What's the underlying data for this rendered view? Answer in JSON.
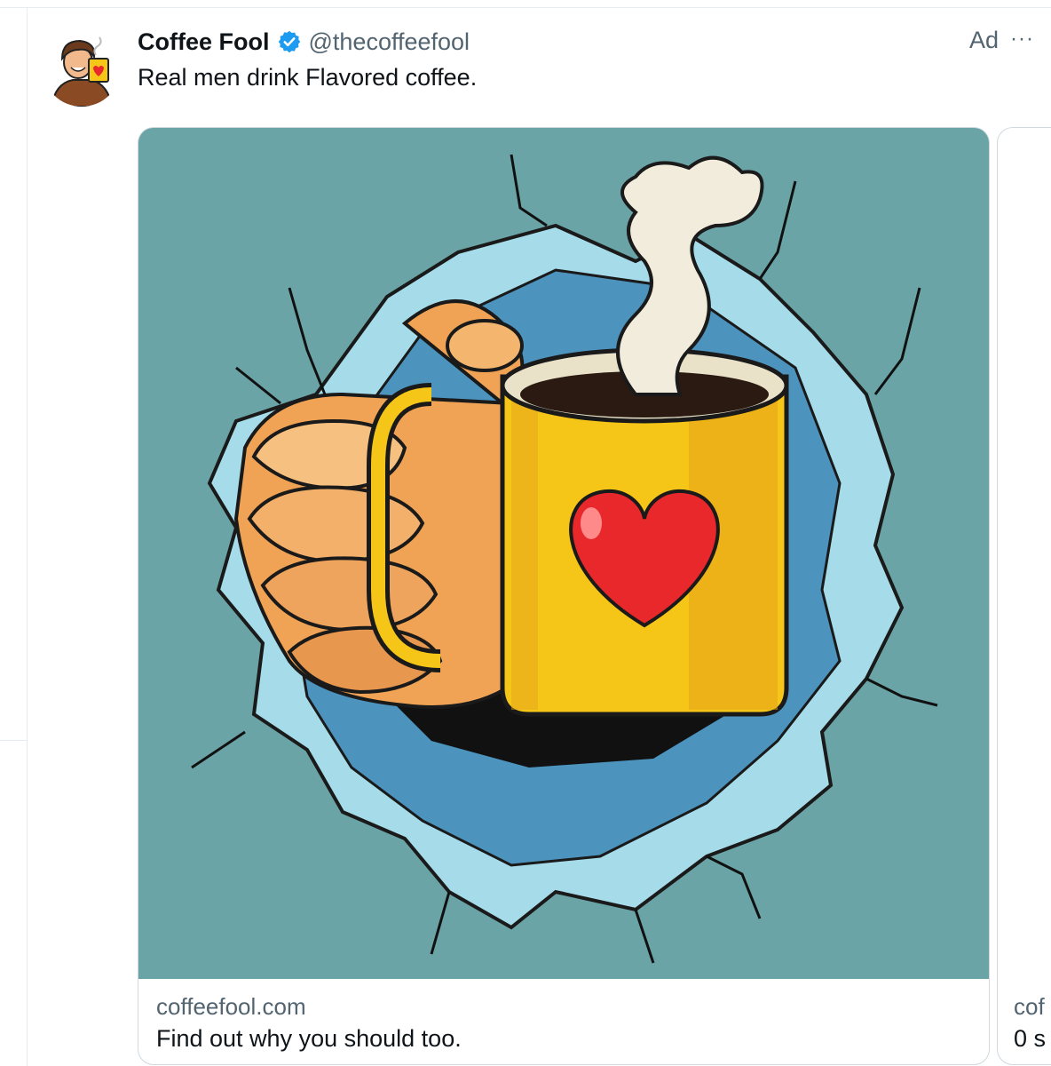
{
  "tweet": {
    "display_name": "Coffee Fool",
    "handle": "@thecoffeefool",
    "ad_label": "Ad",
    "more_label": "···",
    "text": "Real men drink Flavored coffee."
  },
  "cards": [
    {
      "domain": "coffeefool.com",
      "description": "Find out why you should too."
    },
    {
      "domain": "cof",
      "description": "0 s"
    }
  ],
  "icons": {
    "verified": "verified-badge-icon",
    "more": "more-options-icon"
  },
  "colors": {
    "verified_blue": "#1d9bf0",
    "text_primary": "#0f1419",
    "text_secondary": "#536471",
    "image_background": "#6ba4a7",
    "mug_yellow": "#f5c518",
    "heart_red": "#e8282b"
  }
}
